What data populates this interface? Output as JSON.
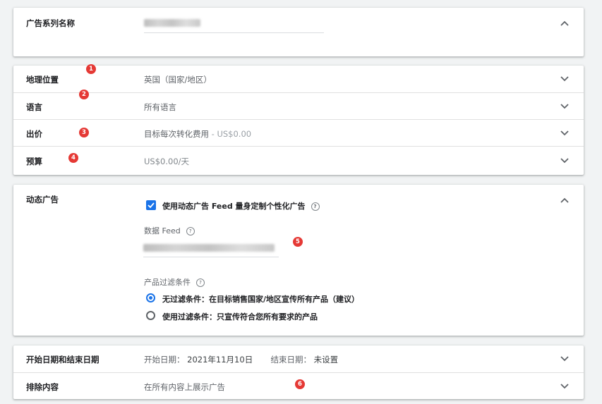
{
  "campaign_name": {
    "label": "广告系列名称"
  },
  "settings": {
    "location": {
      "label": "地理位置",
      "value": "英国（国家/地区）"
    },
    "language": {
      "label": "语言",
      "value": "所有语言"
    },
    "bidding": {
      "label": "出价",
      "value_main": "目标每次转化费用",
      "value_suffix": " - US$0.00"
    },
    "budget": {
      "label": "预算",
      "value": "US$0.00/天"
    }
  },
  "dynamic_ads": {
    "label": "动态广告",
    "checkbox_label": "使用动态广告 Feed 量身定制个性化广告",
    "checked": true,
    "feed_label": "数据 Feed",
    "filter_label": "产品过滤条件",
    "options": [
      {
        "label": "无过滤条件：在目标销售国家/地区宣传所有产品（建议）",
        "selected": true
      },
      {
        "label": "使用过滤条件：只宣传符合您所有要求的产品",
        "selected": false
      }
    ]
  },
  "schedule": {
    "label": "开始日期和结束日期",
    "start_label": "开始日期：",
    "start_value": "2021年11月10日",
    "end_label": "结束日期：",
    "end_value": "未设置"
  },
  "exclusions": {
    "label": "排除内容",
    "value": "在所有内容上展示广告"
  },
  "badges": [
    "1",
    "2",
    "3",
    "4",
    "5",
    "6"
  ],
  "help_glyph": "?",
  "colors": {
    "accent": "#1a73e8",
    "badge": "#e53935"
  }
}
